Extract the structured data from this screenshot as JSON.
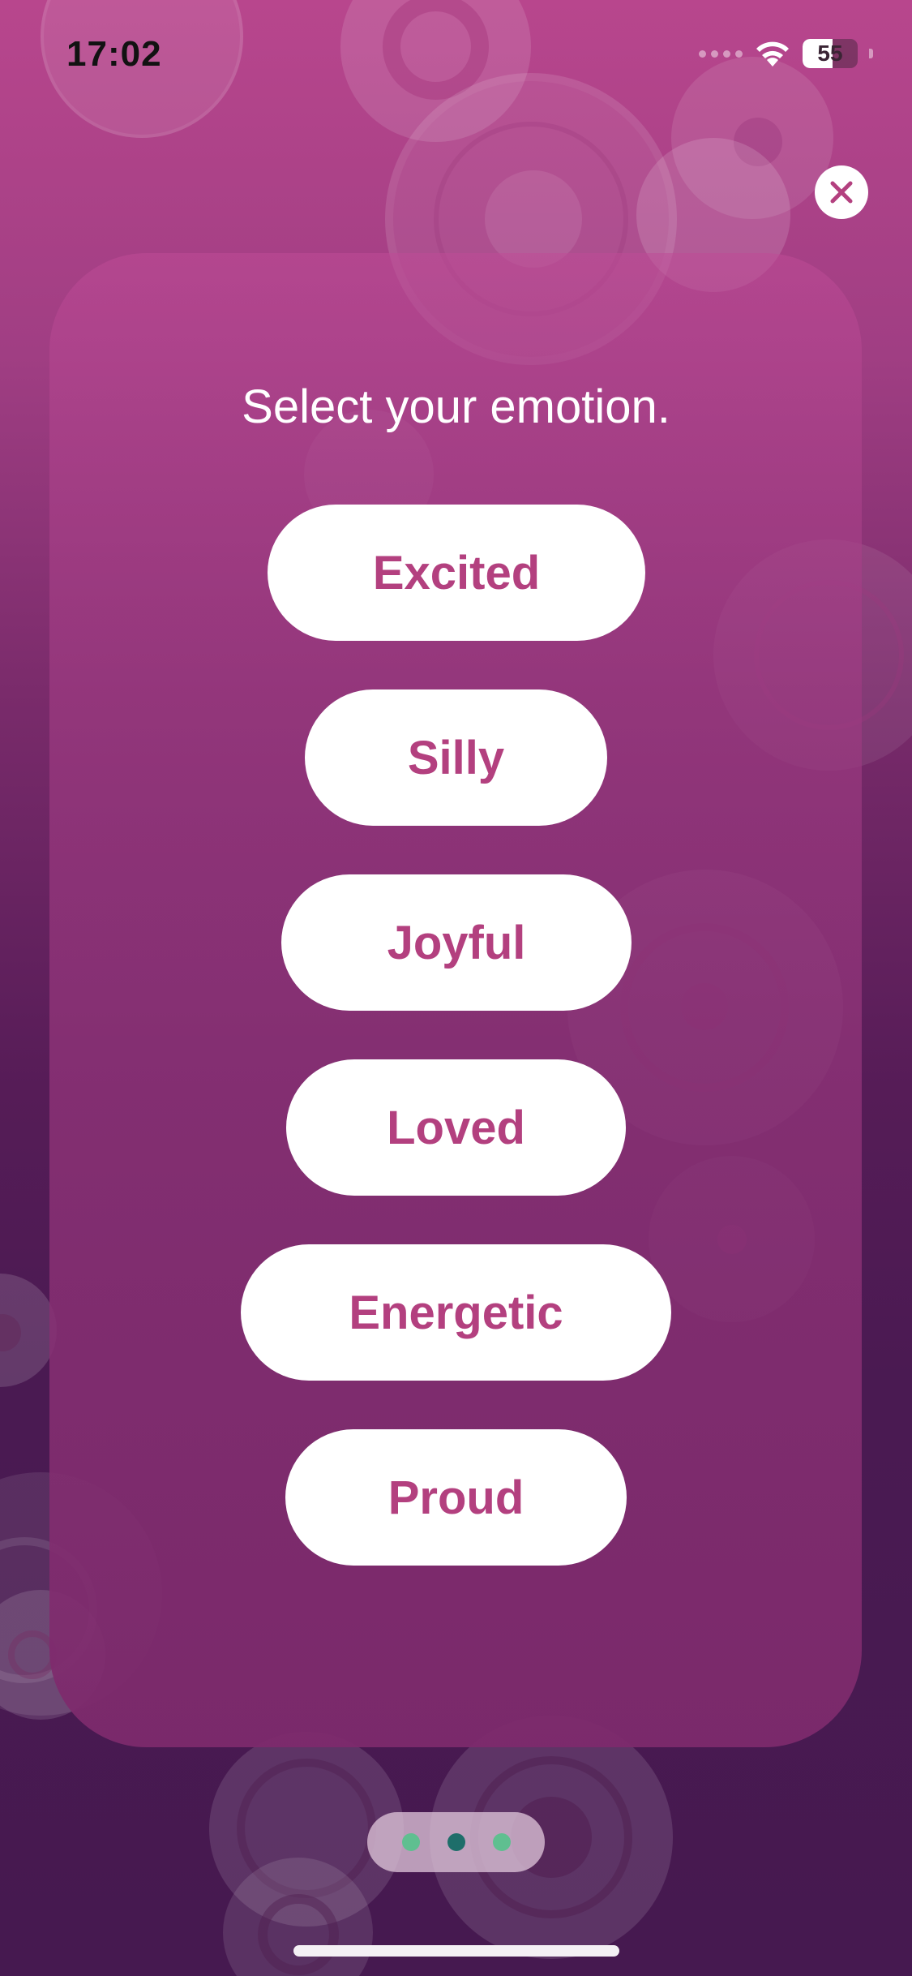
{
  "status_bar": {
    "time": "17:02",
    "battery_level": "55"
  },
  "close_icon": "close-icon",
  "prompt": {
    "title": "Select your emotion."
  },
  "emotions": [
    "Excited",
    "Silly",
    "Joyful",
    "Loved",
    "Energetic",
    "Proud"
  ],
  "pager": {
    "page_count": 3,
    "active_page": 2
  },
  "colors": {
    "accent": "#b3407f",
    "pager_active": "#1e6e6a",
    "pager_inactive": "#5fbf90"
  }
}
